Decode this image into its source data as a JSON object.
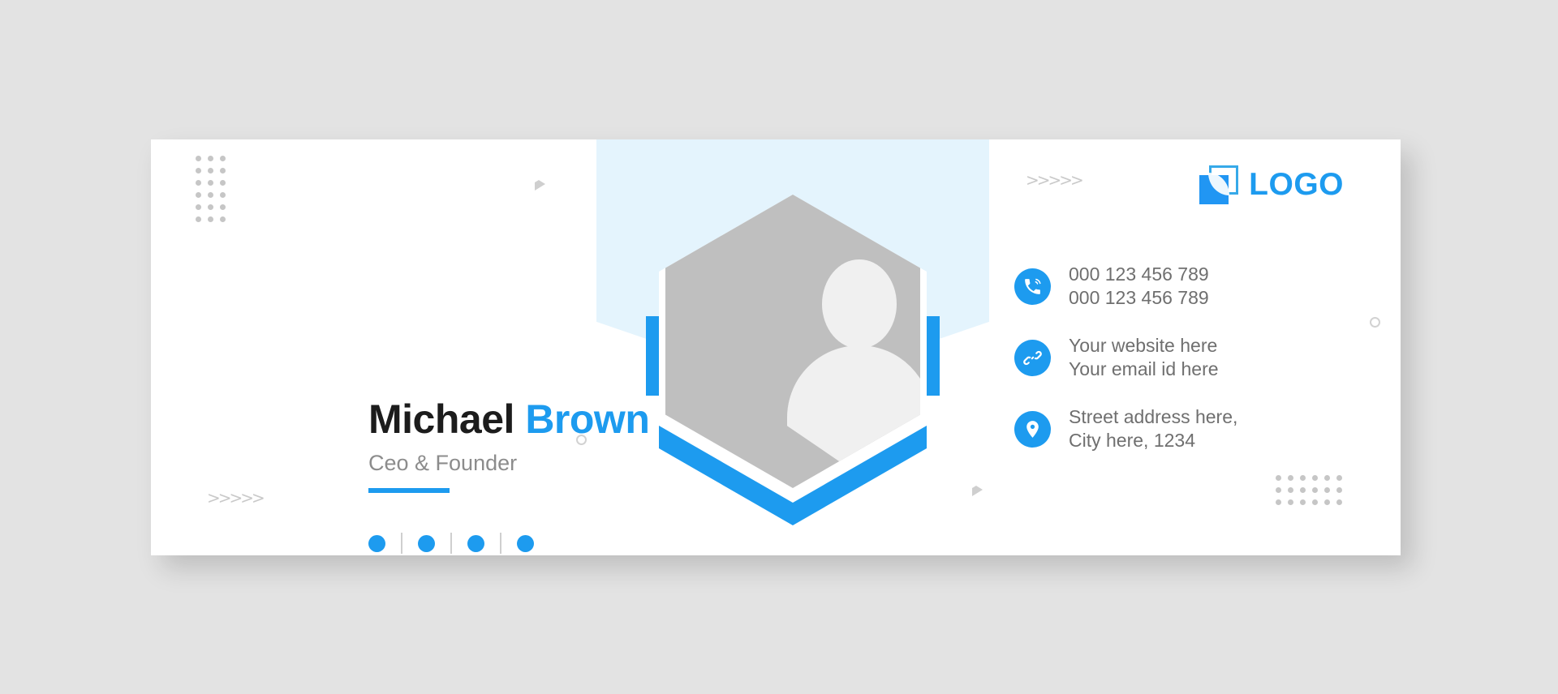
{
  "card": {
    "accent_color": "#1d9bef",
    "band_color": "#e4f4fd",
    "background_color": "#e3e3e3",
    "surface_color": "#ffffff"
  },
  "profile": {
    "first_name": "Michael",
    "last_name": "Brown",
    "role": "Ceo & Founder",
    "avatar_alt": "user-placeholder-avatar"
  },
  "brand": {
    "logo_text": "LOGO",
    "logo_icon": "overlapping-squares-leaf-icon"
  },
  "contacts": [
    {
      "icon": "phone-icon",
      "line1": "000 123 456 789",
      "line2": "000 123 456 789"
    },
    {
      "icon": "link-icon",
      "line1": "Your website here",
      "line2": "Your email id here"
    },
    {
      "icon": "location-pin-icon",
      "line1": "Street address here,",
      "line2": "City here, 1234"
    }
  ],
  "socials": {
    "count": 4,
    "items": [
      {
        "label": "social-dot-1"
      },
      {
        "label": "social-dot-2"
      },
      {
        "label": "social-dot-3"
      },
      {
        "label": "social-dot-4"
      }
    ]
  },
  "decor": {
    "chevrons": ">>>>>",
    "dot_grid_top_left": {
      "columns": 3,
      "rows": 6
    },
    "dot_grid_bottom_right": {
      "columns": 6,
      "rows": 3
    }
  }
}
